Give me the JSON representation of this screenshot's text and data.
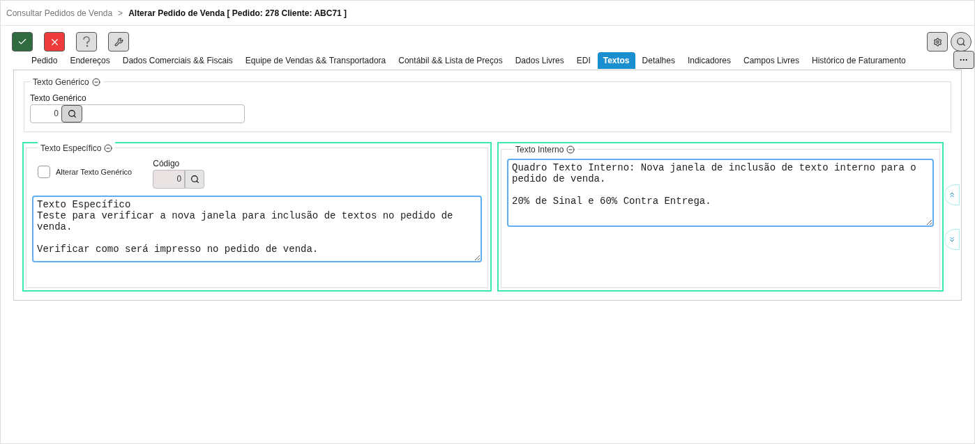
{
  "breadcrumb": {
    "parent": "Consultar Pedidos de Venda",
    "separator": ">",
    "current": "Alterar Pedido de Venda [ Pedido: 278 Cliente: ABC71 ]"
  },
  "tabs": [
    {
      "label": "Pedido",
      "selected": false
    },
    {
      "label": "Endereços",
      "selected": false
    },
    {
      "label": "Dados Comerciais && Fiscais",
      "selected": false
    },
    {
      "label": "Equipe de Vendas && Transportadora",
      "selected": false
    },
    {
      "label": "Contábil && Lista de Preços",
      "selected": false
    },
    {
      "label": "Dados Livres",
      "selected": false
    },
    {
      "label": "EDI",
      "selected": false
    },
    {
      "label": "Textos",
      "selected": true
    },
    {
      "label": "Detalhes",
      "selected": false
    },
    {
      "label": "Indicadores",
      "selected": false
    },
    {
      "label": "Campos Livres",
      "selected": false
    },
    {
      "label": "Histórico de Faturamento",
      "selected": false
    }
  ],
  "more_button": "···",
  "texto_generico": {
    "legend": "Texto Genérico",
    "label": "Texto Genérico",
    "code": "0"
  },
  "texto_especifico": {
    "legend": "Texto Específico",
    "checkbox": {
      "label": "Alterar Texto Genérico",
      "checked": false
    },
    "code_label": "Código",
    "code": "0",
    "text": "Texto Específico\nTeste para verificar a nova janela para inclusão de textos no pedido de venda.\n\nVerificar como será impresso no pedido de venda."
  },
  "texto_interno": {
    "legend": "Texto Interno",
    "text": "Quadro Texto Interno: Nova janela de inclusão de texto interno para o pedido de venda.\n\n20% de Sinal e 60% Contra Entrega."
  }
}
